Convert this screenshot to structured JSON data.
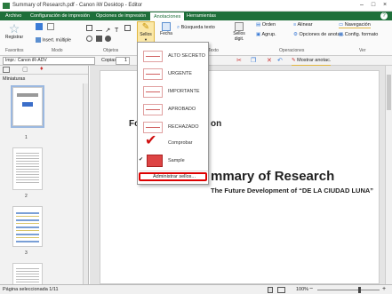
{
  "window": {
    "title": "Summary of Research.pdf - Canon iW Desktop - Editor"
  },
  "tabs": [
    "Archivo",
    "Configuración de impresión",
    "Opciones de impresión",
    "Anotaciones",
    "Herramientas"
  ],
  "ribbon": {
    "register": "Registrar",
    "insert_multiple": "Insert. múltiple",
    "stamps": "Sellos",
    "date": "Fecha",
    "find_text": "Búsqueda texto",
    "digital_stamps": "Sellos digit.",
    "order": "Orden",
    "group": "Agrup.",
    "align": "Alinear",
    "annot_options": "Opciones de anotac.",
    "navigation": "Navegación",
    "format_config": "Config. formato",
    "groups": {
      "favorites": "Favoritos",
      "mode": "Modo",
      "objects": "Objetos",
      "text": "Texto",
      "operations": "Operaciones",
      "view": "Ver"
    }
  },
  "toolbar": {
    "printer": "Impr.: Canon iR-ADV",
    "copies_label": "Copias",
    "copies_value": "1",
    "show_annotations": "Mostrar anotac."
  },
  "sidebar": {
    "title": "Miniaturas",
    "pages": [
      "1",
      "2",
      "3"
    ]
  },
  "document": {
    "heading_partial": "Fo",
    "heading_partial2": "on",
    "title": "mmary of Research",
    "subtitle": "The Future Development of “DE LA CIUDAD LUNA”"
  },
  "stamp_menu": {
    "items": [
      {
        "label": "ALTO SECRETO",
        "checked": false
      },
      {
        "label": "URGENTE",
        "checked": false
      },
      {
        "label": "IMPORTANTE",
        "checked": false
      },
      {
        "label": "APROBADO",
        "checked": false
      },
      {
        "label": "RECHAZADO",
        "checked": false
      },
      {
        "label": "Comprobar",
        "checked": false
      },
      {
        "label": "Sample",
        "checked": true
      }
    ],
    "admin": "Administrar sellos..."
  },
  "status": {
    "selected_page": "Página seleccionada 1/11",
    "zoom": "100%"
  },
  "colors": {
    "accent": "#1e6f3a",
    "highlight": "#dd0000"
  }
}
